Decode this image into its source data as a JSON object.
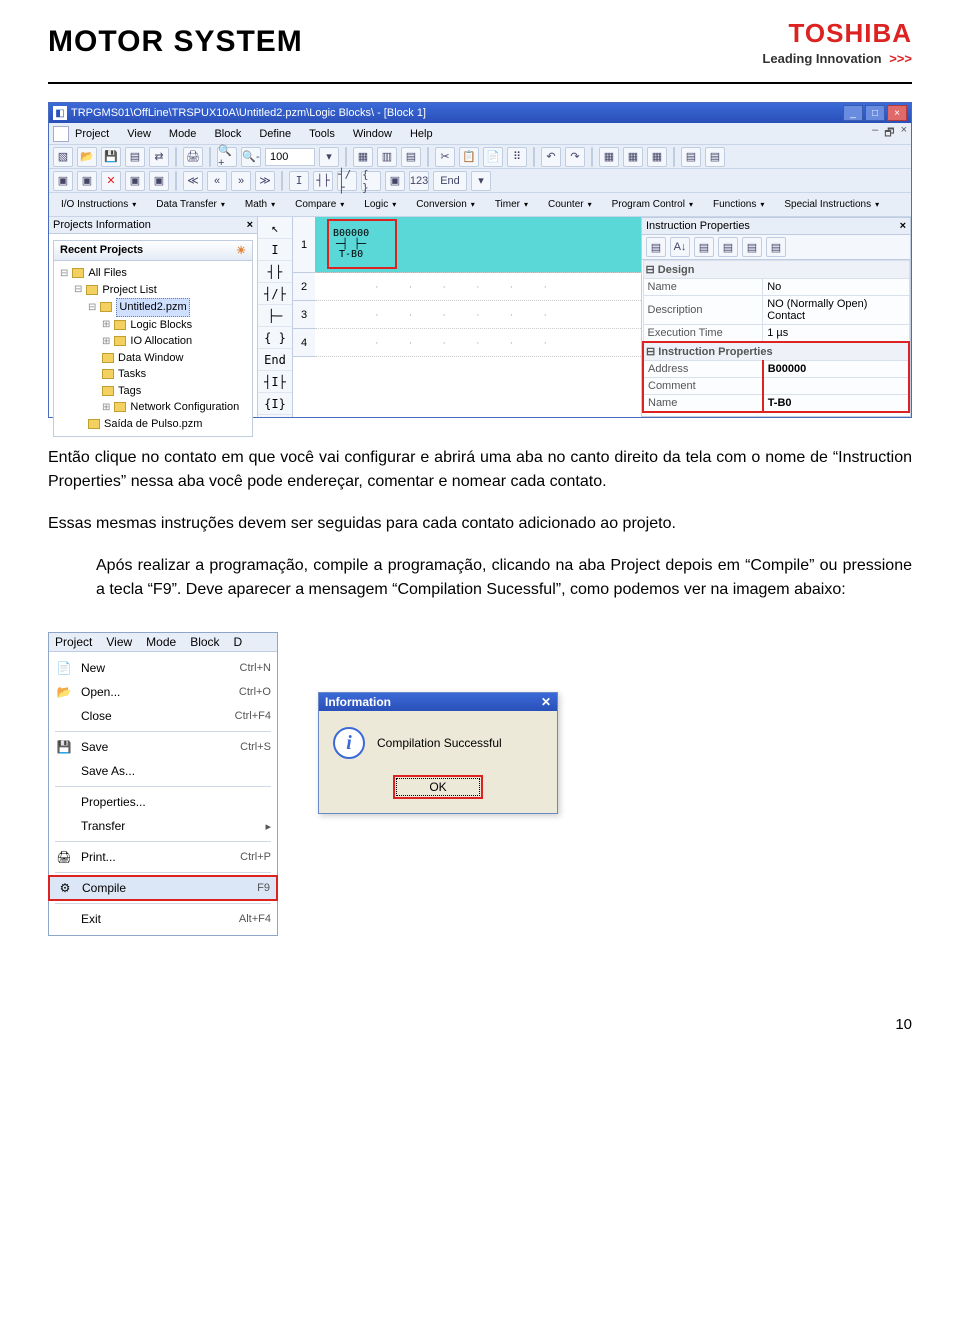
{
  "header": {
    "logo_left": "MOTOR SYSTEM",
    "brand": "TOSHIBA",
    "tagline": "Leading Innovation",
    "chevrons": ">>>"
  },
  "ide": {
    "window_title": "TRPGMS01\\OffLine\\TRSPUX10A\\Untitled2.pzm\\Logic Blocks\\ - [Block 1]",
    "menu": [
      "Project",
      "View",
      "Mode",
      "Block",
      "Define",
      "Tools",
      "Window",
      "Help"
    ],
    "mdi_controls": [
      "–",
      "🗗",
      "×"
    ],
    "zoom": "100",
    "toolbar2_labels": {
      "num": "123",
      "end": "End"
    },
    "categories": [
      "I/O Instructions",
      "Data Transfer",
      "Math",
      "Compare",
      "Logic",
      "Conversion",
      "Timer",
      "Counter",
      "Program Control",
      "Functions",
      "Special Instructions"
    ],
    "left_panel_title": "Projects Information",
    "recent_title": "Recent Projects",
    "tree": {
      "all_files": "All Files",
      "project_list": "Project List",
      "project": "Untitled2.pzm",
      "children": [
        "Logic Blocks",
        "IO Allocation",
        "Data Window",
        "Tasks",
        "Tags",
        "Network Configuration"
      ],
      "sibling": "Saída de Pulso.pzm"
    },
    "palette": [
      "↖",
      "I",
      "┤├",
      "┤/├",
      "├─",
      "{ }",
      "End",
      "┤I├",
      "{I}"
    ],
    "rung_nums": [
      "1",
      "2",
      "3",
      "4"
    ],
    "contact": {
      "addr": "B00000",
      "name": "T-B0"
    },
    "right_panel_title": "Instruction Properties",
    "props": {
      "design_cat": "Design",
      "name_k": "Name",
      "name_v": "No",
      "desc_k": "Description",
      "desc_v": "NO (Normally Open) Contact",
      "exec_k": "Execution Time",
      "exec_v": "1 µs",
      "inst_cat": "Instruction Properties",
      "addr_k": "Address",
      "addr_v": "B00000",
      "comm_k": "Comment",
      "comm_v": "",
      "iname_k": "Name",
      "iname_v": "T-B0"
    }
  },
  "paragraphs": {
    "p1": "Então clique no contato em que você vai configurar e abrirá uma aba no canto direito da tela com o nome de “Instruction Properties” nessa aba você pode endereçar, comentar e nomear cada contato.",
    "p2": "Essas mesmas instruções devem ser seguidas para cada contato adicionado ao projeto.",
    "p3": "Após realizar a programação, compile a programação, clicando na aba Project depois em “Compile” ou pressione a tecla “F9”. Deve aparecer a mensagem “Compilation Sucessful”, como podemos ver na imagem abaixo:"
  },
  "menu_shot": {
    "top": [
      "Project",
      "View",
      "Mode",
      "Block",
      "D"
    ],
    "items": [
      {
        "icon": "📄",
        "label": "New",
        "key": "Ctrl+N"
      },
      {
        "icon": "📂",
        "label": "Open...",
        "key": "Ctrl+O"
      },
      {
        "icon": "",
        "label": "Close",
        "key": "Ctrl+F4"
      },
      {
        "sep": true
      },
      {
        "icon": "💾",
        "label": "Save",
        "key": "Ctrl+S"
      },
      {
        "icon": "",
        "label": "Save As...",
        "key": ""
      },
      {
        "sep": true
      },
      {
        "icon": "",
        "label": "Properties...",
        "key": ""
      },
      {
        "icon": "",
        "label": "Transfer",
        "key": "▸"
      },
      {
        "sep": true
      },
      {
        "icon": "🖨",
        "label": "Print...",
        "key": "Ctrl+P"
      },
      {
        "sep": true
      },
      {
        "icon": "⚙",
        "label": "Compile",
        "key": "F9",
        "hi": true
      },
      {
        "sep": true
      },
      {
        "icon": "",
        "label": "Exit",
        "key": "Alt+F4"
      }
    ]
  },
  "info_dialog": {
    "title": "Information",
    "close": "✕",
    "message": "Compilation Successful",
    "ok": "OK"
  },
  "page_number": "10"
}
